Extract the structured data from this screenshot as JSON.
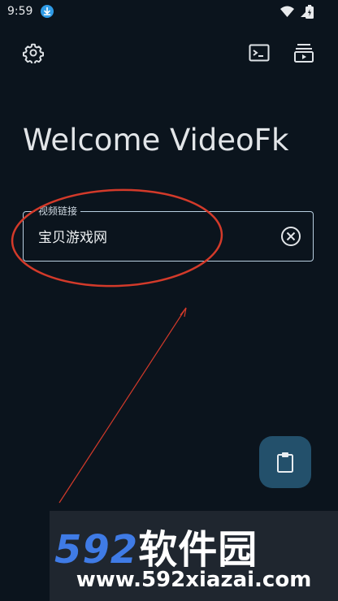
{
  "status_bar": {
    "time": "9:59"
  },
  "header": {
    "title": "Welcome VideoFk"
  },
  "video_link_field": {
    "label": "视频链接",
    "value": "宝贝游戏网"
  },
  "watermark": {
    "brand_number": "592",
    "brand_text": "软件园",
    "url": "www.592xiazai.com"
  },
  "colors": {
    "background": "#0b141d",
    "fab": "#23506b",
    "annotation": "#d33a2a",
    "field_border": "#b8cfe0"
  },
  "icons": [
    "download-icon",
    "wifi-icon",
    "signal-icon",
    "battery-icon",
    "settings-icon",
    "terminal-icon",
    "playlist-icon",
    "clear-icon",
    "clipboard-icon"
  ]
}
